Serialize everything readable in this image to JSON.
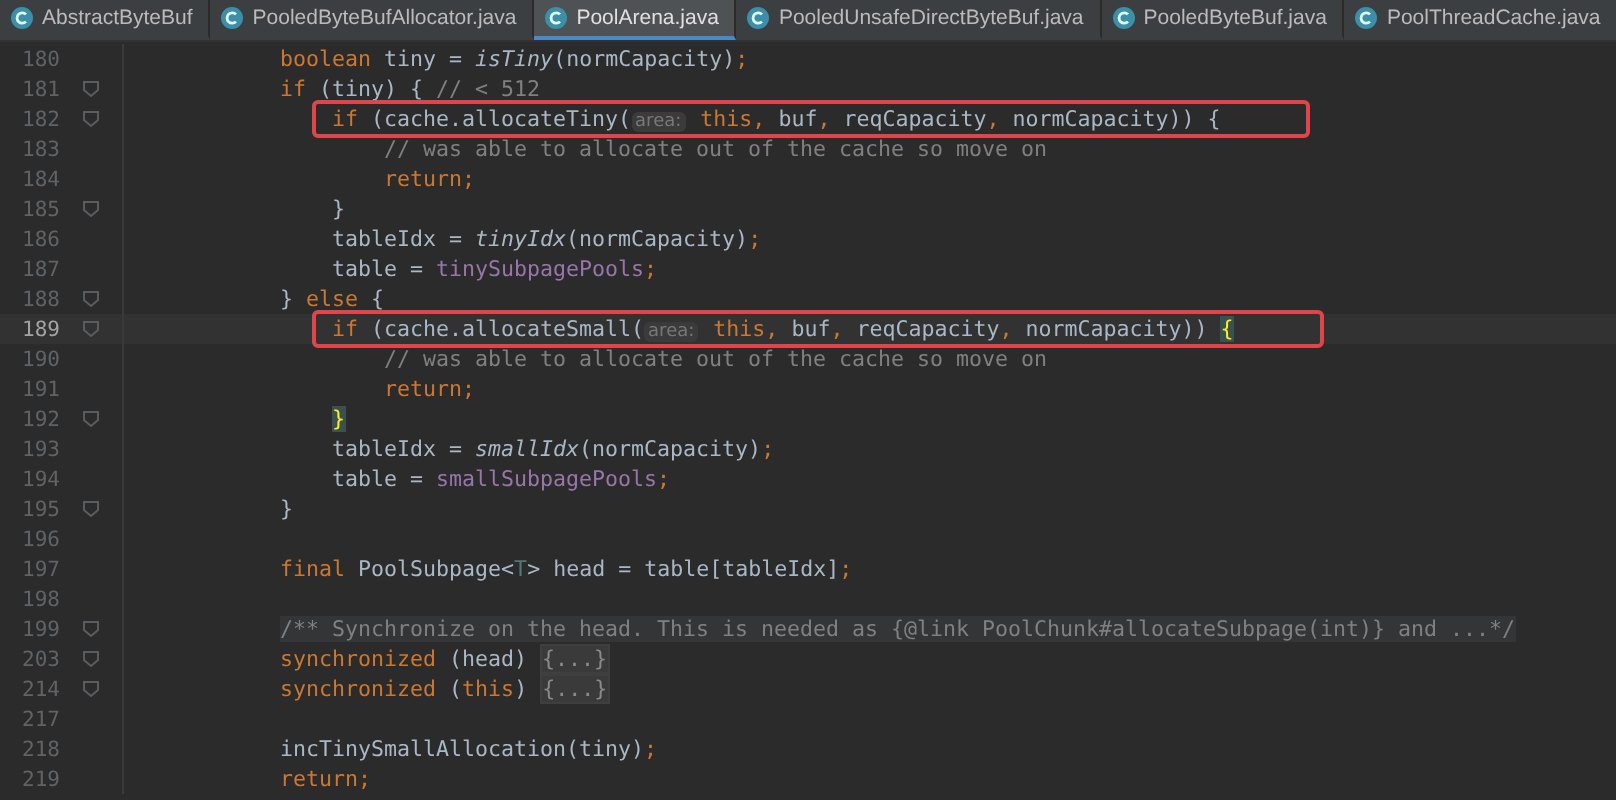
{
  "tabs": [
    {
      "label": "AbstractByteBuf",
      "selected": false
    },
    {
      "label": "PooledByteBufAllocator.java",
      "selected": false
    },
    {
      "label": "PoolArena.java",
      "selected": true
    },
    {
      "label": "PooledUnsafeDirectByteBuf.java",
      "selected": false
    },
    {
      "label": "PooledByteBuf.java",
      "selected": false
    },
    {
      "label": "PoolThreadCache.java",
      "selected": false
    }
  ],
  "editor": {
    "lines": [
      {
        "number": "180",
        "current": false,
        "fold_marker": false,
        "highlighted": false,
        "tokens": [
          {
            "t": "            boolean",
            "kind": "kw"
          },
          {
            "t": " tiny = ",
            "kind": "txt"
          },
          {
            "t": "isTiny",
            "kind": "it"
          },
          {
            "t": "(normCapacity)",
            "kind": "txt"
          },
          {
            "t": ";",
            "kind": "punct"
          }
        ]
      },
      {
        "number": "181",
        "current": false,
        "fold_marker": true,
        "highlighted": false,
        "tokens": [
          {
            "t": "            if",
            "kind": "kw"
          },
          {
            "t": " (tiny) { ",
            "kind": "txt"
          },
          {
            "t": "// < 512",
            "kind": "cm"
          }
        ]
      },
      {
        "number": "182",
        "current": false,
        "fold_marker": true,
        "highlighted": true,
        "tokens": [
          {
            "t": "                if",
            "kind": "kw"
          },
          {
            "t": " (cache.allocateTiny(",
            "kind": "txt"
          },
          {
            "t": "area:",
            "kind": "hint"
          },
          {
            "t": " this",
            "kind": "kw"
          },
          {
            "t": ",",
            "kind": "punct"
          },
          {
            "t": " buf",
            "kind": "txt"
          },
          {
            "t": ",",
            "kind": "punct"
          },
          {
            "t": " reqCapacity",
            "kind": "txt"
          },
          {
            "t": ",",
            "kind": "punct"
          },
          {
            "t": " normCapacity)) {",
            "kind": "txt"
          }
        ]
      },
      {
        "number": "183",
        "current": false,
        "fold_marker": false,
        "highlighted": false,
        "tokens": [
          {
            "t": "                    // was able to allocate out of the cache so move on",
            "kind": "cm"
          }
        ]
      },
      {
        "number": "184",
        "current": false,
        "fold_marker": false,
        "highlighted": false,
        "tokens": [
          {
            "t": "                    return",
            "kind": "kw"
          },
          {
            "t": ";",
            "kind": "punct"
          }
        ]
      },
      {
        "number": "185",
        "current": false,
        "fold_marker": true,
        "highlighted": false,
        "tokens": [
          {
            "t": "                }",
            "kind": "txt"
          }
        ]
      },
      {
        "number": "186",
        "current": false,
        "fold_marker": false,
        "highlighted": false,
        "tokens": [
          {
            "t": "                tableIdx = ",
            "kind": "txt"
          },
          {
            "t": "tinyIdx",
            "kind": "it"
          },
          {
            "t": "(normCapacity)",
            "kind": "txt"
          },
          {
            "t": ";",
            "kind": "punct"
          }
        ]
      },
      {
        "number": "187",
        "current": false,
        "fold_marker": false,
        "highlighted": false,
        "tokens": [
          {
            "t": "                table = ",
            "kind": "txt"
          },
          {
            "t": "tinySubpagePools",
            "kind": "fd"
          },
          {
            "t": ";",
            "kind": "punct"
          }
        ]
      },
      {
        "number": "188",
        "current": false,
        "fold_marker": true,
        "highlighted": false,
        "tokens": [
          {
            "t": "            } ",
            "kind": "txt"
          },
          {
            "t": "else",
            "kind": "kw"
          },
          {
            "t": " {",
            "kind": "txt"
          }
        ]
      },
      {
        "number": "189",
        "current": true,
        "fold_marker": true,
        "highlighted": true,
        "tokens": [
          {
            "t": "                if",
            "kind": "kw"
          },
          {
            "t": " (cache.allocateSmall(",
            "kind": "txt"
          },
          {
            "t": "area:",
            "kind": "hint"
          },
          {
            "t": " this",
            "kind": "kw"
          },
          {
            "t": ",",
            "kind": "punct"
          },
          {
            "t": " buf",
            "kind": "txt"
          },
          {
            "t": ",",
            "kind": "punct"
          },
          {
            "t": " reqCapacity",
            "kind": "txt"
          },
          {
            "t": ",",
            "kind": "punct"
          },
          {
            "t": " normCapacity)) ",
            "kind": "txt"
          },
          {
            "t": "{",
            "kind": "match"
          }
        ]
      },
      {
        "number": "190",
        "current": false,
        "fold_marker": false,
        "highlighted": false,
        "tokens": [
          {
            "t": "                    // was able to allocate out of the cache so move on",
            "kind": "cm"
          }
        ]
      },
      {
        "number": "191",
        "current": false,
        "fold_marker": false,
        "highlighted": false,
        "tokens": [
          {
            "t": "                    return",
            "kind": "kw"
          },
          {
            "t": ";",
            "kind": "punct"
          }
        ]
      },
      {
        "number": "192",
        "current": false,
        "fold_marker": true,
        "highlighted": false,
        "tokens": [
          {
            "t": "                }",
            "kind": "match"
          }
        ]
      },
      {
        "number": "193",
        "current": false,
        "fold_marker": false,
        "highlighted": false,
        "tokens": [
          {
            "t": "                tableIdx = ",
            "kind": "txt"
          },
          {
            "t": "smallIdx",
            "kind": "it"
          },
          {
            "t": "(normCapacity)",
            "kind": "txt"
          },
          {
            "t": ";",
            "kind": "punct"
          }
        ]
      },
      {
        "number": "194",
        "current": false,
        "fold_marker": false,
        "highlighted": false,
        "tokens": [
          {
            "t": "                table = ",
            "kind": "txt"
          },
          {
            "t": "smallSubpagePools",
            "kind": "fd"
          },
          {
            "t": ";",
            "kind": "punct"
          }
        ]
      },
      {
        "number": "195",
        "current": false,
        "fold_marker": true,
        "highlighted": false,
        "tokens": [
          {
            "t": "            }",
            "kind": "txt"
          }
        ]
      },
      {
        "number": "196",
        "current": false,
        "fold_marker": false,
        "highlighted": false
      },
      {
        "number": "197",
        "current": false,
        "fold_marker": false,
        "highlighted": false,
        "tokens": [
          {
            "t": "            final",
            "kind": "kw"
          },
          {
            "t": " PoolSubpage<",
            "kind": "txt"
          },
          {
            "t": "T",
            "kind": "type"
          },
          {
            "t": "> head = table[tableIdx]",
            "kind": "txt"
          },
          {
            "t": ";",
            "kind": "punct"
          }
        ]
      },
      {
        "number": "198",
        "current": false,
        "fold_marker": false,
        "highlighted": false
      },
      {
        "number": "199",
        "current": false,
        "fold_marker": true,
        "highlighted": false,
        "tokens": [
          {
            "t": "            /** Synchronize on the head. This is needed as {@link PoolChunk#allocateSubpage(int)} and ...*/",
            "kind": "doc"
          }
        ]
      },
      {
        "number": "203",
        "current": false,
        "fold_marker": true,
        "highlighted": false,
        "tokens": [
          {
            "t": "            synchronized",
            "kind": "kw"
          },
          {
            "t": " (head) ",
            "kind": "txt"
          },
          {
            "t": "{...}",
            "kind": "fold"
          }
        ]
      },
      {
        "number": "214",
        "current": false,
        "fold_marker": true,
        "highlighted": false,
        "tokens": [
          {
            "t": "            synchronized",
            "kind": "kw"
          },
          {
            "t": " (",
            "kind": "txt"
          },
          {
            "t": "this",
            "kind": "kw"
          },
          {
            "t": ") ",
            "kind": "txt"
          },
          {
            "t": "{...}",
            "kind": "fold"
          }
        ]
      },
      {
        "number": "217",
        "current": false,
        "fold_marker": false,
        "highlighted": false
      },
      {
        "number": "218",
        "current": false,
        "fold_marker": false,
        "highlighted": false,
        "tokens": [
          {
            "t": "            incTinySmallAllocation(tiny)",
            "kind": "txt"
          },
          {
            "t": ";",
            "kind": "punct"
          }
        ]
      },
      {
        "number": "219",
        "current": false,
        "fold_marker": false,
        "highlighted": false,
        "tokens": [
          {
            "t": "            return",
            "kind": "kw"
          },
          {
            "t": ";",
            "kind": "punct"
          }
        ]
      }
    ]
  }
}
